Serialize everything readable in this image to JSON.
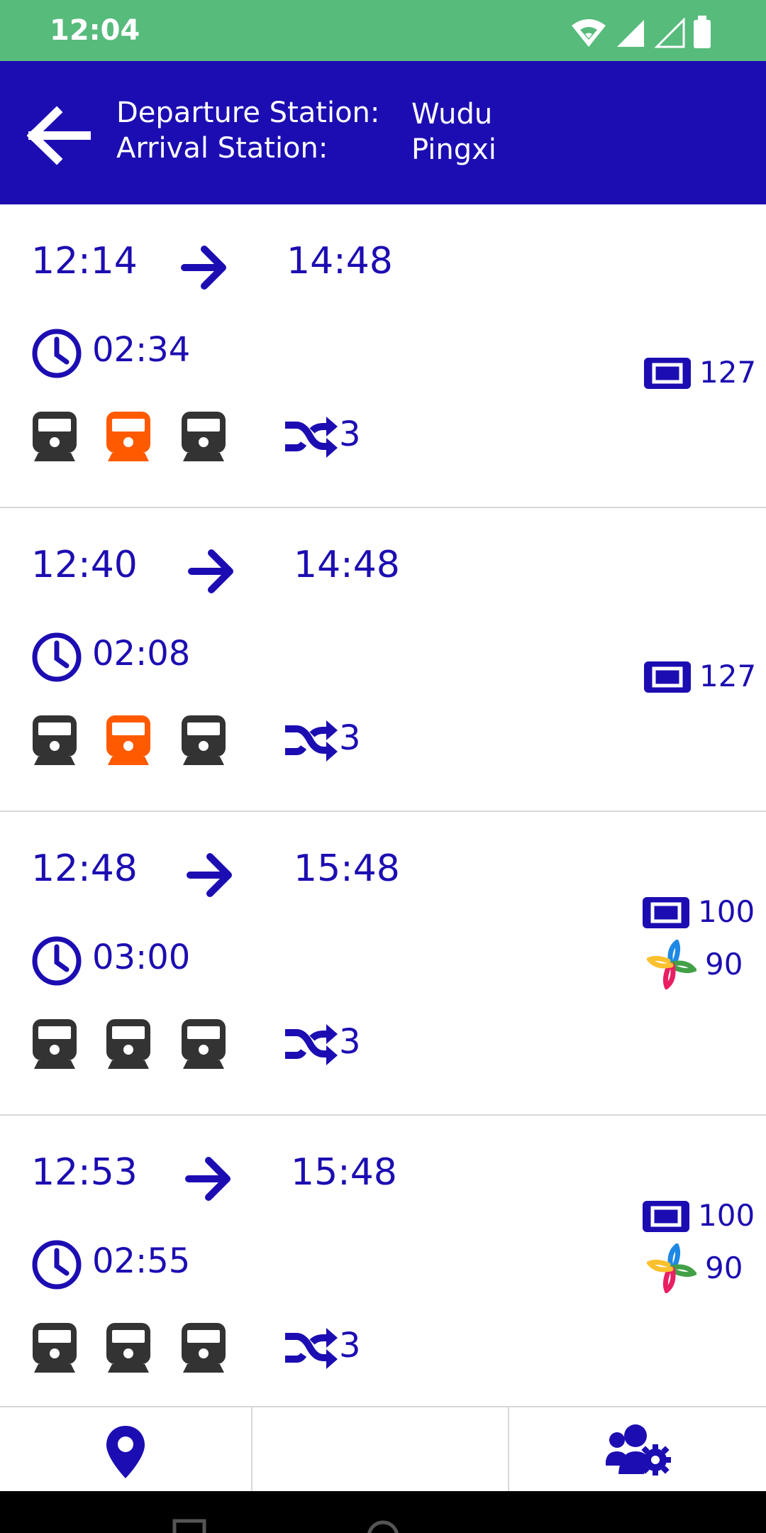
{
  "status_bar": {
    "time": "12:04"
  },
  "header": {
    "departure_label": "Departure Station:",
    "departure_value": "Wudu",
    "arrival_label": "Arrival Station:",
    "arrival_value": "Pingxi"
  },
  "trips": [
    {
      "depart": "12:14",
      "arrive": "14:48",
      "duration": "02:34",
      "transfers": "3",
      "ticket_price": "127",
      "alt_price": "",
      "trains": [
        "dark",
        "orange",
        "dark"
      ]
    },
    {
      "depart": "12:40",
      "arrive": "14:48",
      "duration": "02:08",
      "transfers": "3",
      "ticket_price": "127",
      "alt_price": "",
      "trains": [
        "dark",
        "orange",
        "dark"
      ]
    },
    {
      "depart": "12:48",
      "arrive": "15:48",
      "duration": "03:00",
      "transfers": "3",
      "ticket_price": "100",
      "alt_price": "90",
      "trains": [
        "dark",
        "dark",
        "dark"
      ]
    },
    {
      "depart": "12:53",
      "arrive": "15:48",
      "duration": "02:55",
      "transfers": "3",
      "ticket_price": "100",
      "alt_price": "90",
      "trains": [
        "dark",
        "dark",
        "dark"
      ]
    }
  ],
  "bottom_nav": {
    "tabs": [
      "location-tab",
      "empty-tab",
      "users-settings-tab"
    ]
  },
  "colors": {
    "status_bar": "#57bb7c",
    "header": "#1c0db2",
    "accent": "#1c0db2",
    "train_dark": "#333333",
    "train_orange": "#ff5a00"
  }
}
